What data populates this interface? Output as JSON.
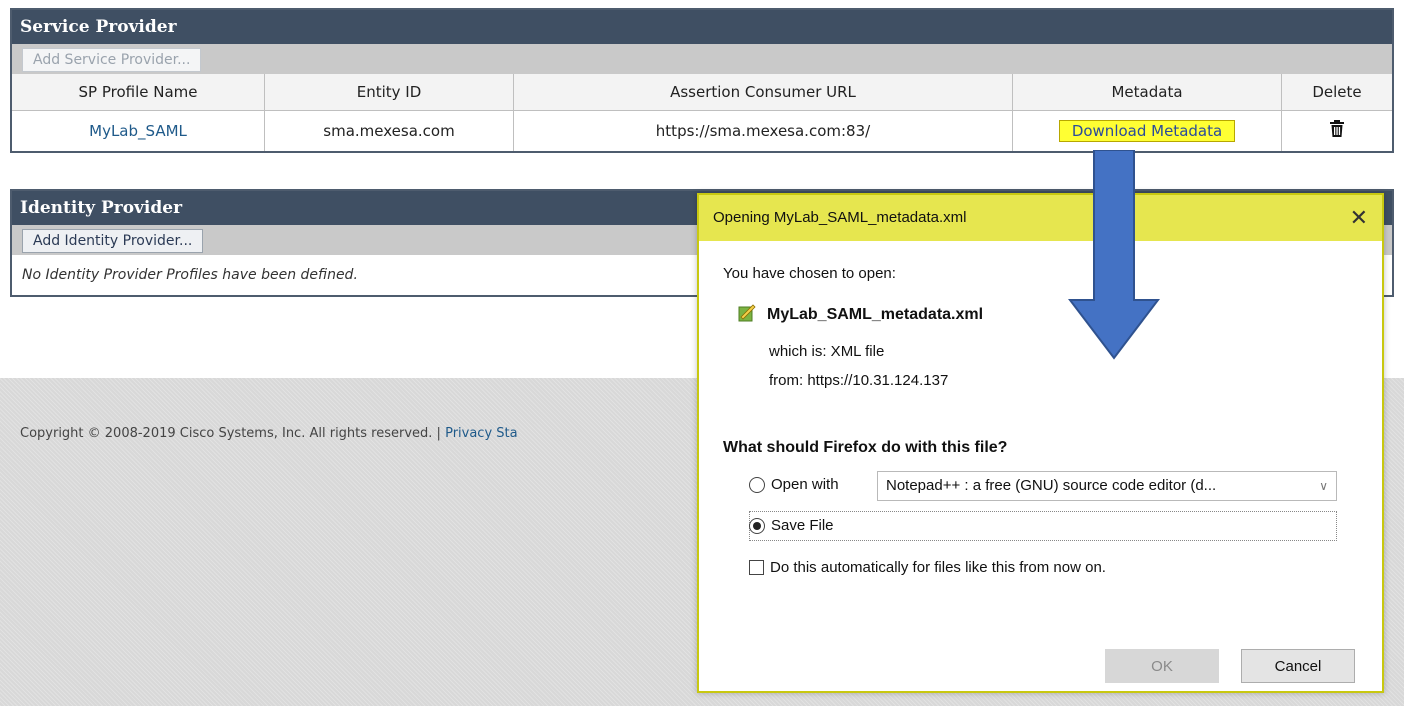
{
  "service_provider": {
    "title": "Service Provider",
    "add_button": "Add Service Provider...",
    "columns": [
      "SP Profile Name",
      "Entity ID",
      "Assertion Consumer URL",
      "Metadata",
      "Delete"
    ],
    "row": {
      "profile_name": "MyLab_SAML",
      "entity_id": "sma.mexesa.com",
      "acs_url": "https://sma.mexesa.com:83/",
      "metadata_button": "Download Metadata",
      "delete_icon": "trash-icon"
    }
  },
  "identity_provider": {
    "title": "Identity Provider",
    "add_button": "Add Identity Provider...",
    "empty_message": "No Identity Provider Profiles have been defined."
  },
  "footer": {
    "copyright": "Copyright © 2008-2019 Cisco Systems, Inc. All rights reserved. |",
    "privacy_link": "Privacy Sta"
  },
  "dialog": {
    "title": "Opening MyLab_SAML_metadata.xml",
    "close": "✕",
    "chosen_label": "You have chosen to open:",
    "file_name": "MyLab_SAML_metadata.xml",
    "which_is": "which is:  XML file",
    "from": "from:  https://10.31.124.137",
    "question": "What should Firefox do with this file?",
    "open_with_label": "Open with",
    "open_with_app": "Notepad++ : a free (GNU) source code editor (d...",
    "save_file_label": "Save File",
    "selected_option": "Save File",
    "auto_label": "Do this automatically for files like this from now on.",
    "ok_label": "OK",
    "cancel_label": "Cancel"
  },
  "colors": {
    "section_header": "#3f4f63",
    "highlight_yellow": "#ffff33",
    "dialog_title_bar": "#e6e64f",
    "arrow_blue": "#4472c4"
  }
}
